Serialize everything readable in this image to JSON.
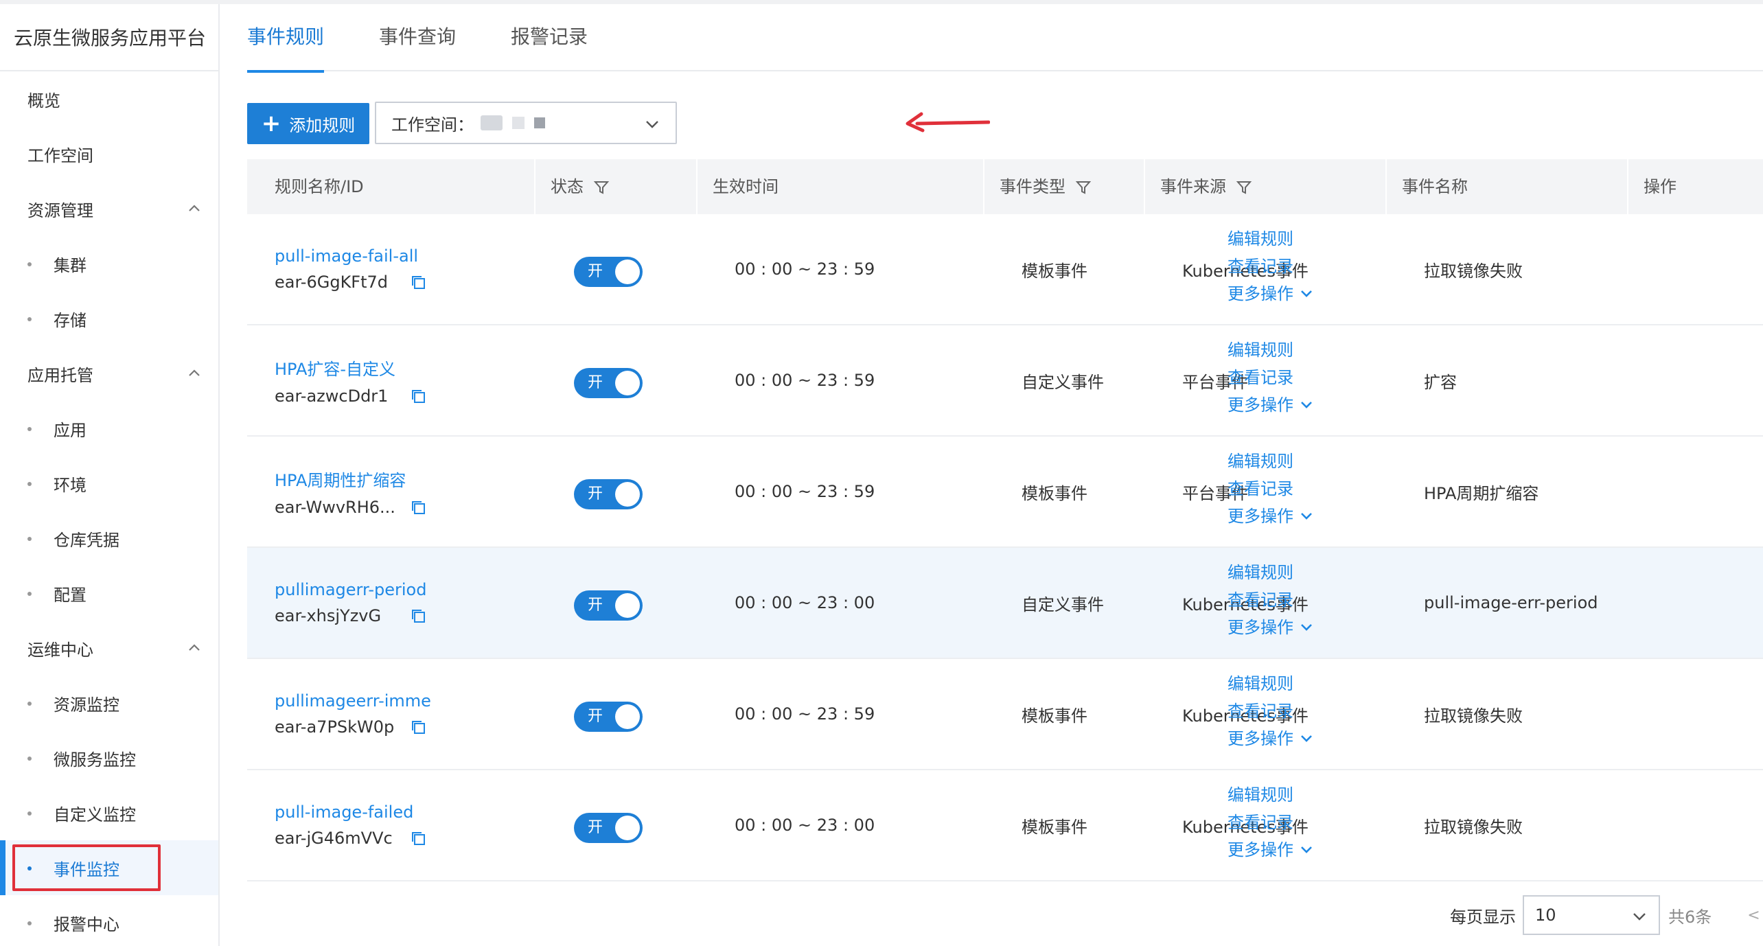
{
  "brand": "云原生微服务应用平台",
  "sidebar": {
    "overview": "概览",
    "workspace": "工作空间",
    "resource_mgmt": "资源管理",
    "cluster": "集群",
    "storage": "存储",
    "app_hosting": "应用托管",
    "application": "应用",
    "environment": "环境",
    "repo_credentials": "仓库凭据",
    "config": "配置",
    "ops_center": "运维中心",
    "resource_monitor": "资源监控",
    "microservice_monitor": "微服务监控",
    "custom_monitor": "自定义监控",
    "event_monitor": "事件监控",
    "alert_center": "报警中心"
  },
  "tabs": [
    "事件规则",
    "事件查询",
    "报警记录"
  ],
  "toolbar": {
    "add_label": "添加规则",
    "workspace_label": "工作空间："
  },
  "table": {
    "headers": {
      "name": "规则名称/ID",
      "status": "状态",
      "time": "生效时间",
      "type": "事件类型",
      "source": "事件来源",
      "event_name": "事件名称",
      "ops": "操作"
    },
    "ops": {
      "edit": "编辑规则",
      "view": "查看记录",
      "more": "更多操作"
    },
    "rows": [
      {
        "name": "pull-image-fail-all",
        "id": "ear-6GgKFt7d",
        "status": "开",
        "time": "00 : 00 ~ 23 : 59",
        "type": "模板事件",
        "source": "Kubernetes事件",
        "event_name": "拉取镜像失败"
      },
      {
        "name": "HPA扩容-自定义",
        "id": "ear-azwcDdr1",
        "status": "开",
        "time": "00 : 00 ~ 23 : 59",
        "type": "自定义事件",
        "source": "平台事件",
        "event_name": "扩容"
      },
      {
        "name": "HPA周期性扩缩容",
        "id": "ear-WwvRH6...",
        "status": "开",
        "time": "00 : 00 ~ 23 : 59",
        "type": "模板事件",
        "source": "平台事件",
        "event_name": "HPA周期扩缩容"
      },
      {
        "name": "pullimagerr-period",
        "id": "ear-xhsjYzvG",
        "status": "开",
        "time": "00 : 00 ~ 23 : 00",
        "type": "自定义事件",
        "source": "Kubernetes事件",
        "event_name": "pull-image-err-period"
      },
      {
        "name": "pullimageerr-imme",
        "id": "ear-a7PSkW0p",
        "status": "开",
        "time": "00 : 00 ~ 23 : 59",
        "type": "模板事件",
        "source": "Kubernetes事件",
        "event_name": "拉取镜像失败"
      },
      {
        "name": "pull-image-failed",
        "id": "ear-jG46mVVc",
        "status": "开",
        "time": "00 : 00 ~ 23 : 00",
        "type": "模板事件",
        "source": "Kubernetes事件",
        "event_name": "拉取镜像失败"
      }
    ]
  },
  "pagination": {
    "per_page_label": "每页显示",
    "page_size": "10",
    "total": "共6条",
    "prev": "<"
  },
  "colors": {
    "accent": "#1e7fd6",
    "link": "#1e88e5",
    "highlight_row": "#f0f6fc",
    "annotation_red": "#e0303a"
  }
}
